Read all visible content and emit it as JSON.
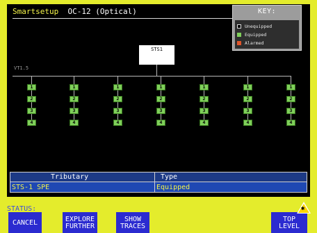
{
  "header": {
    "app_name": "Smartsetup",
    "interface": "OC-12 (Optical)"
  },
  "key": {
    "title": "KEY:",
    "items": [
      {
        "label": "Unequipped",
        "color": "#000000"
      },
      {
        "label": "Equipped",
        "color": "#7fcf5a"
      },
      {
        "label": "Alarmed",
        "color": "#e0552a"
      }
    ]
  },
  "diagram": {
    "root_label": "STS1",
    "level_label": "VT1.5",
    "groups": [
      {
        "tributaries": [
          "1",
          "2",
          "3",
          "4"
        ]
      },
      {
        "tributaries": [
          "1",
          "2",
          "3",
          "4"
        ]
      },
      {
        "tributaries": [
          "1",
          "2",
          "3",
          "4"
        ]
      },
      {
        "tributaries": [
          "1",
          "2",
          "3",
          "4"
        ]
      },
      {
        "tributaries": [
          "1",
          "2",
          "3",
          "4"
        ]
      },
      {
        "tributaries": [
          "1",
          "2",
          "3",
          "4"
        ]
      },
      {
        "tributaries": [
          "1",
          "2",
          "3",
          "4"
        ]
      }
    ]
  },
  "table": {
    "headers": [
      "Tributary",
      "Type"
    ],
    "row": [
      "STS-1 SPE",
      "Equipped"
    ]
  },
  "status": {
    "label": "STATUS:"
  },
  "softkeys": [
    {
      "line1": "CANCEL",
      "line2": ""
    },
    {
      "line1": "EXPLORE",
      "line2": "FURTHER"
    },
    {
      "line1": "SHOW",
      "line2": "TRACES"
    },
    {
      "line1": "TOP",
      "line2": "LEVEL"
    }
  ],
  "colors": {
    "bezel": "#e4ec2c",
    "equipped": "#7fcf5a",
    "softkey": "#2b2bd0",
    "title_text": "#f4f44a"
  }
}
